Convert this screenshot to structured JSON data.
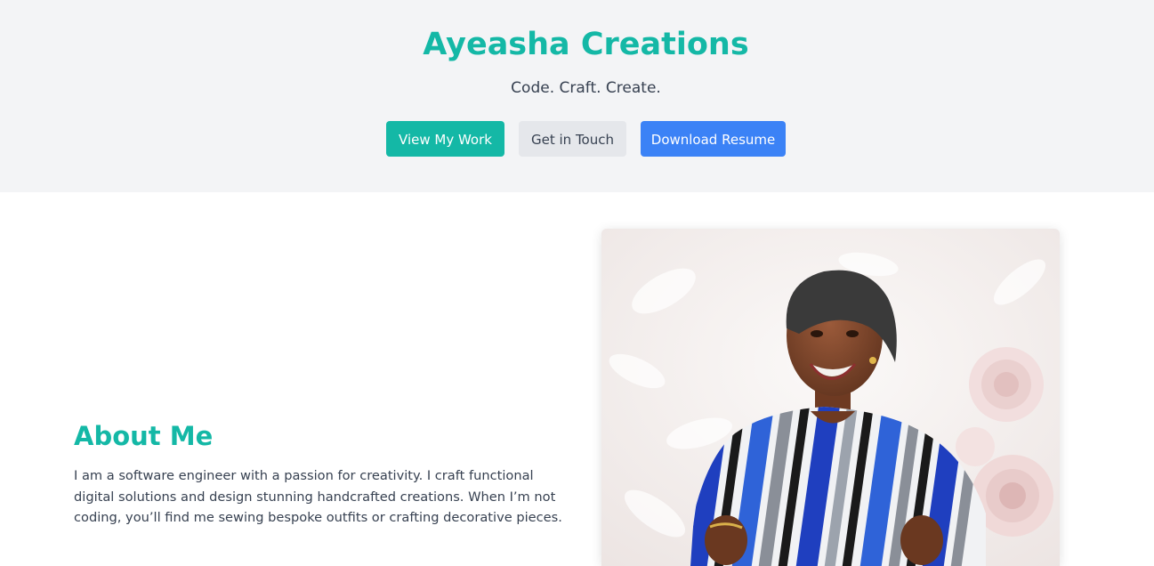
{
  "hero": {
    "title": "Ayeasha Creations",
    "tagline": "Code. Craft. Create.",
    "buttons": {
      "view_work": "View My Work",
      "get_in_touch": "Get in Touch",
      "download_resume": "Download Resume"
    }
  },
  "about": {
    "heading": "About Me",
    "body": "I am a software engineer with a passion for creativity. I craft functional digital solutions and design stunning handcrafted creations. When I’m not coding, you’ll find me sewing bespoke outfits or crafting decorative pieces."
  },
  "colors": {
    "accent": "#14b8a6",
    "primary_blue": "#3b82f6",
    "hero_bg": "#f3f4f6",
    "secondary_button_bg": "#e5e7eb",
    "text": "#374151"
  }
}
